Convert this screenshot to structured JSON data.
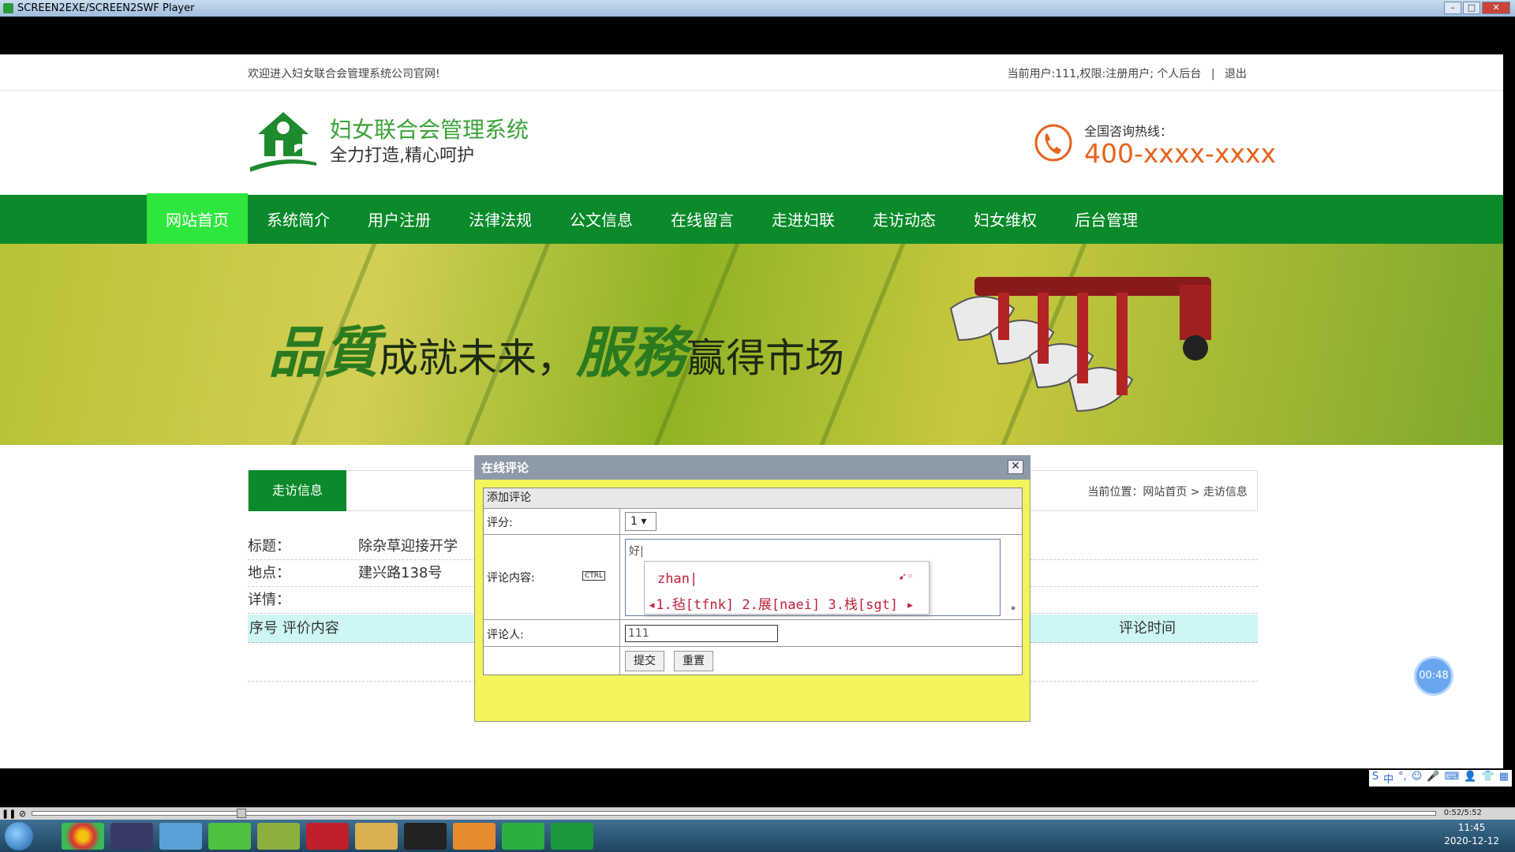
{
  "window": {
    "title": "SCREEN2EXE/SCREEN2SWF Player",
    "controls": [
      "–",
      "□",
      "✕"
    ]
  },
  "site": {
    "welcome": "欢迎进入妇女联合会管理系统公司官网!",
    "user_info": "当前用户:111,权限:注册用户;",
    "personal": "个人后台",
    "separator": "|",
    "logout": "退出",
    "title": "妇女联合会管理系统",
    "slogan": "全力打造,精心呵护",
    "hotline_label": "全国咨询热线：",
    "hotline_number": "400-xxxx-xxxx"
  },
  "nav": [
    "网站首页",
    "系统简介",
    "用户注册",
    "法律法规",
    "公文信息",
    "在线留言",
    "走进妇联",
    "走访动态",
    "妇女维权",
    "后台管理"
  ],
  "banner": {
    "big1": "品質",
    "t1": "成就未来，",
    "big2": "服務",
    "t2": "赢得市场"
  },
  "content": {
    "tab": "走访信息",
    "breadcrumb": "当前位置：网站首页 > 走访信息",
    "title_label": "标题：",
    "title_value": "除杂草迎接开学",
    "place_label": "地点：",
    "place_value": "建兴路138号",
    "detail_label": "详情：",
    "col1": "序号 评价内容",
    "col2": "评论时间"
  },
  "dialog": {
    "title": "在线评论",
    "close": "✕",
    "header": "添加评论",
    "score_label": "评分:",
    "score_value": "1 ▾",
    "content_label": "评论内容:",
    "ctrl_badge": "CTRL",
    "content_value": "好|",
    "star": "*",
    "reviewer_label": "评论人:",
    "reviewer_value": "111",
    "submit": "提交",
    "reset": "重置"
  },
  "ime": {
    "pinyin": "zhan|",
    "candidates": "◂1.毡[tfnk] 2.展[naei] 3.栈[sgt] ▸",
    "toolbar": [
      "S",
      "中",
      "°,",
      "☺",
      "🎤",
      "⌨",
      "👤",
      "👕",
      "▦"
    ]
  },
  "player": {
    "timer": "00:48",
    "pos": "0:52/5:52"
  },
  "taskbar": {
    "time": "11:45",
    "date": "2020-12-12"
  },
  "colors": {
    "nav_green": "#0a8a2a",
    "nav_active": "#2ee63c",
    "title_green": "#3aa338",
    "hotline": "#e8631c"
  }
}
